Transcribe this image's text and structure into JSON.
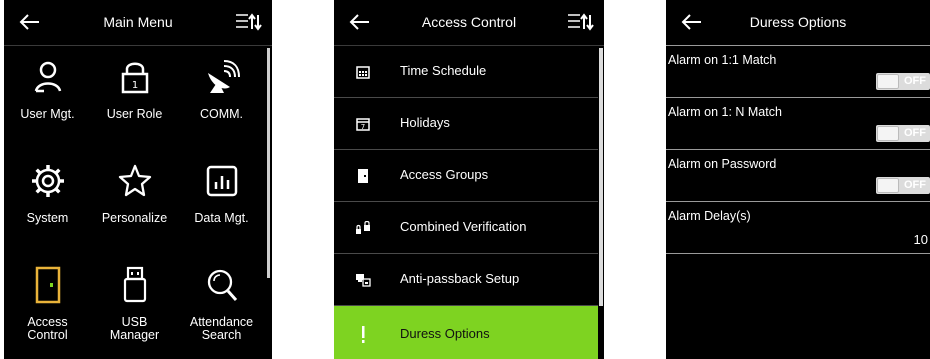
{
  "main_menu": {
    "title": "Main Menu",
    "items": [
      {
        "label": "User Mgt.",
        "icon": "user-icon"
      },
      {
        "label": "User Role",
        "icon": "lock-icon"
      },
      {
        "label": "COMM.",
        "icon": "satellite-dish-icon"
      },
      {
        "label": "System",
        "icon": "gear-icon"
      },
      {
        "label": "Personalize",
        "icon": "star-icon"
      },
      {
        "label": "Data Mgt.",
        "icon": "bar-chart-icon"
      },
      {
        "label": "Access\nControl",
        "icon": "door-icon"
      },
      {
        "label": "USB\nManager",
        "icon": "usb-icon"
      },
      {
        "label": "Attendance\nSearch",
        "icon": "magnifier-icon"
      }
    ]
  },
  "access_control": {
    "title": "Access Control",
    "items": [
      {
        "label": "Time Schedule",
        "icon": "calendar-grid-icon"
      },
      {
        "label": "Holidays",
        "icon": "calendar-7-icon"
      },
      {
        "label": "Access Groups",
        "icon": "door-icon"
      },
      {
        "label": "Combined Verification",
        "icon": "two-locks-icon"
      },
      {
        "label": "Anti-passback Setup",
        "icon": "anti-passback-icon"
      },
      {
        "label": "Duress Options",
        "icon": "exclamation-icon",
        "selected": true
      }
    ],
    "selected_color": "#7ED321"
  },
  "duress_options": {
    "title": "Duress Options",
    "options": [
      {
        "label": "Alarm on 1:1 Match",
        "state": "OFF"
      },
      {
        "label": "Alarm on 1: N Match",
        "state": "OFF"
      },
      {
        "label": "Alarm on Password",
        "state": "OFF"
      },
      {
        "label": "Alarm Delay(s)",
        "value": "10"
      }
    ]
  }
}
